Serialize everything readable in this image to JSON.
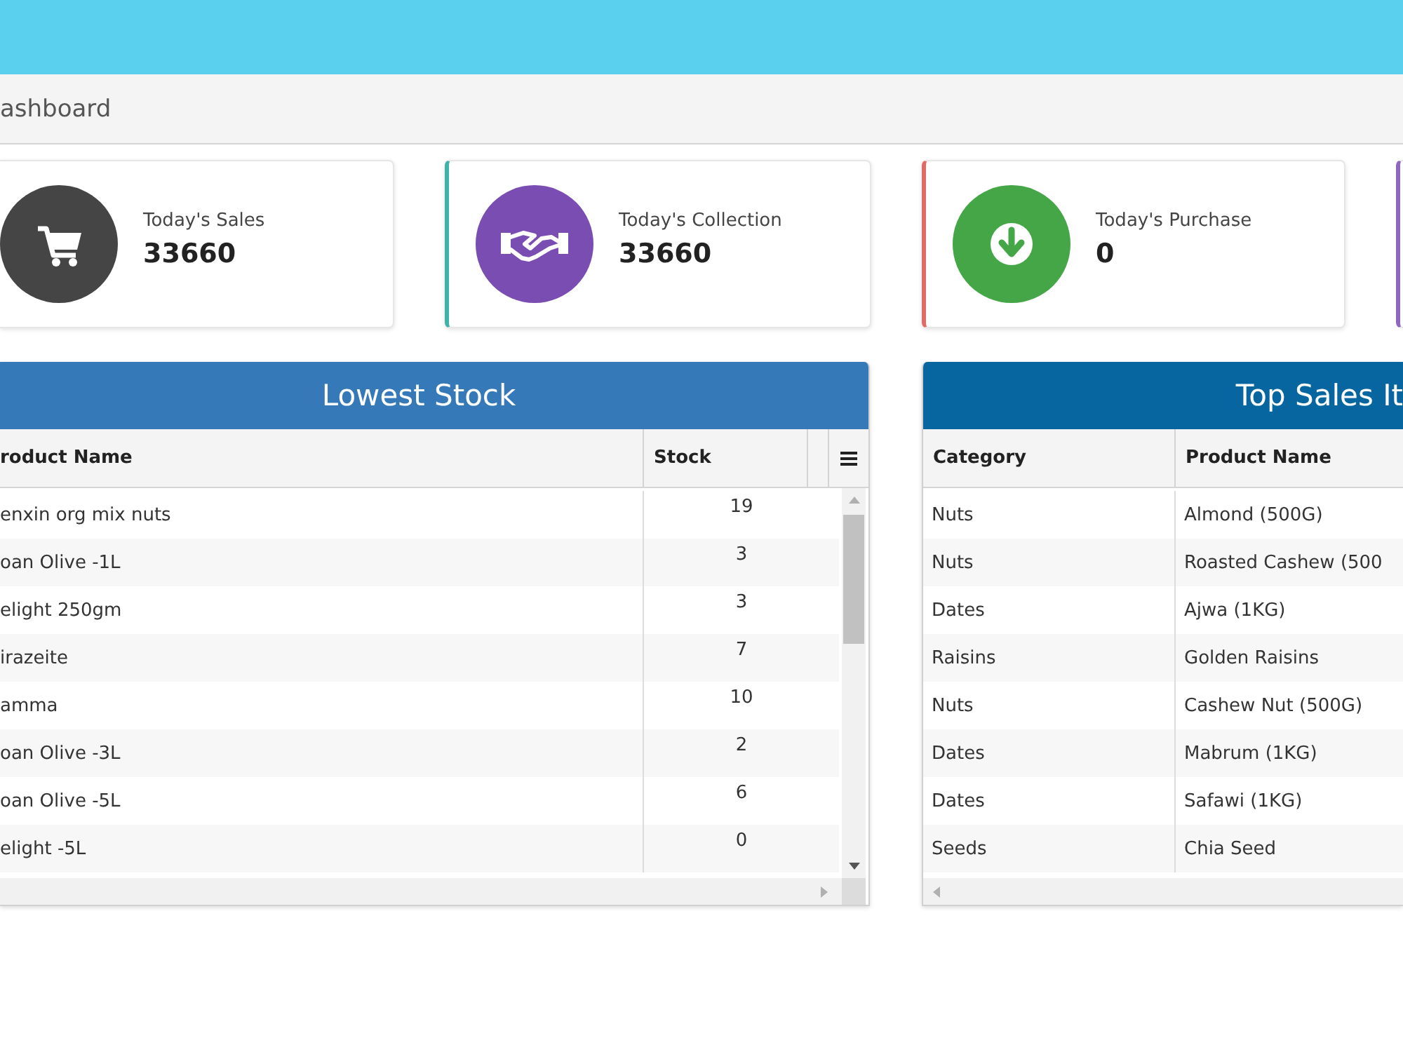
{
  "breadcrumb": {
    "title": "ashboard"
  },
  "stats": [
    {
      "kind": "cart",
      "label": "Today's Sales",
      "value": "33660"
    },
    {
      "kind": "handshake",
      "label": "Today's Collection",
      "value": "33660"
    },
    {
      "kind": "download",
      "label": "Today's Purchase",
      "value": "0"
    }
  ],
  "lowest_stock": {
    "title": "Lowest Stock",
    "columns": [
      "roduct Name",
      "Stock"
    ],
    "rows": [
      {
        "product": "enxin org mix nuts",
        "stock": "19"
      },
      {
        "product": "oan Olive -1L",
        "stock": "3"
      },
      {
        "product": "elight 250gm",
        "stock": "3"
      },
      {
        "product": "irazeite",
        "stock": "7"
      },
      {
        "product": "amma",
        "stock": "10"
      },
      {
        "product": "oan Olive -3L",
        "stock": "2"
      },
      {
        "product": "oan Olive -5L",
        "stock": "6"
      },
      {
        "product": "elight -5L",
        "stock": "0"
      }
    ]
  },
  "top_sales": {
    "title": "Top Sales It",
    "columns": [
      "Category",
      "Product Name"
    ],
    "rows": [
      {
        "category": "Nuts",
        "product": "Almond (500G)"
      },
      {
        "category": "Nuts",
        "product": "Roasted Cashew (500"
      },
      {
        "category": "Dates",
        "product": "Ajwa (1KG)"
      },
      {
        "category": "Raisins",
        "product": "Golden Raisins"
      },
      {
        "category": "Nuts",
        "product": "Cashew Nut (500G)"
      },
      {
        "category": "Dates",
        "product": "Mabrum (1KG)"
      },
      {
        "category": "Dates",
        "product": "Safawi (1KG)"
      },
      {
        "category": "Seeds",
        "product": "Chia Seed"
      }
    ]
  }
}
